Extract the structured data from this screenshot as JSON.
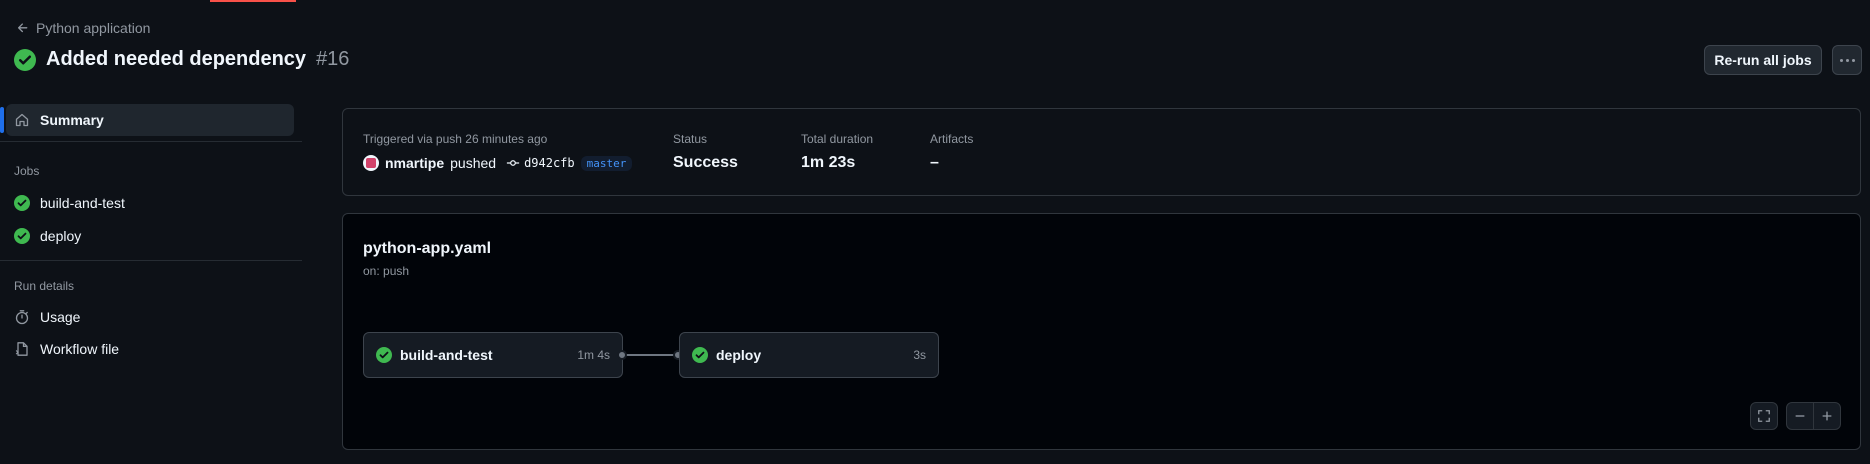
{
  "header": {
    "back_label": "Python application",
    "title": "Added needed dependency",
    "run_number": "#16",
    "rerun_label": "Re-run all jobs",
    "more_icon": "kebab-horizontal-icon"
  },
  "sidebar": {
    "summary_label": "Summary",
    "jobs_heading": "Jobs",
    "jobs": [
      {
        "label": "build-and-test",
        "icon": "check-circle-icon"
      },
      {
        "label": "deploy",
        "icon": "check-circle-icon"
      }
    ],
    "run_details_heading": "Run details",
    "details": [
      {
        "label": "Usage",
        "icon": "stopwatch-icon"
      },
      {
        "label": "Workflow file",
        "icon": "file-icon"
      }
    ]
  },
  "summary": {
    "trigger_label": "Triggered via push 26 minutes ago",
    "actor": "nmartipe",
    "action": "pushed",
    "commit": "d942cfb",
    "branch": "master",
    "status_label": "Status",
    "status_value": "Success",
    "duration_label": "Total duration",
    "duration_value": "1m 23s",
    "artifacts_label": "Artifacts",
    "artifacts_value": "–"
  },
  "workflow": {
    "file": "python-app.yaml",
    "trigger": "on: push",
    "jobs": [
      {
        "name": "build-and-test",
        "duration": "1m 4s",
        "status": "success"
      },
      {
        "name": "deploy",
        "duration": "3s",
        "status": "success"
      }
    ]
  },
  "colors": {
    "success": "#3fb950",
    "accent": "#1f6feb",
    "branch_text": "#4493f8",
    "top_accent": "#f85149"
  }
}
